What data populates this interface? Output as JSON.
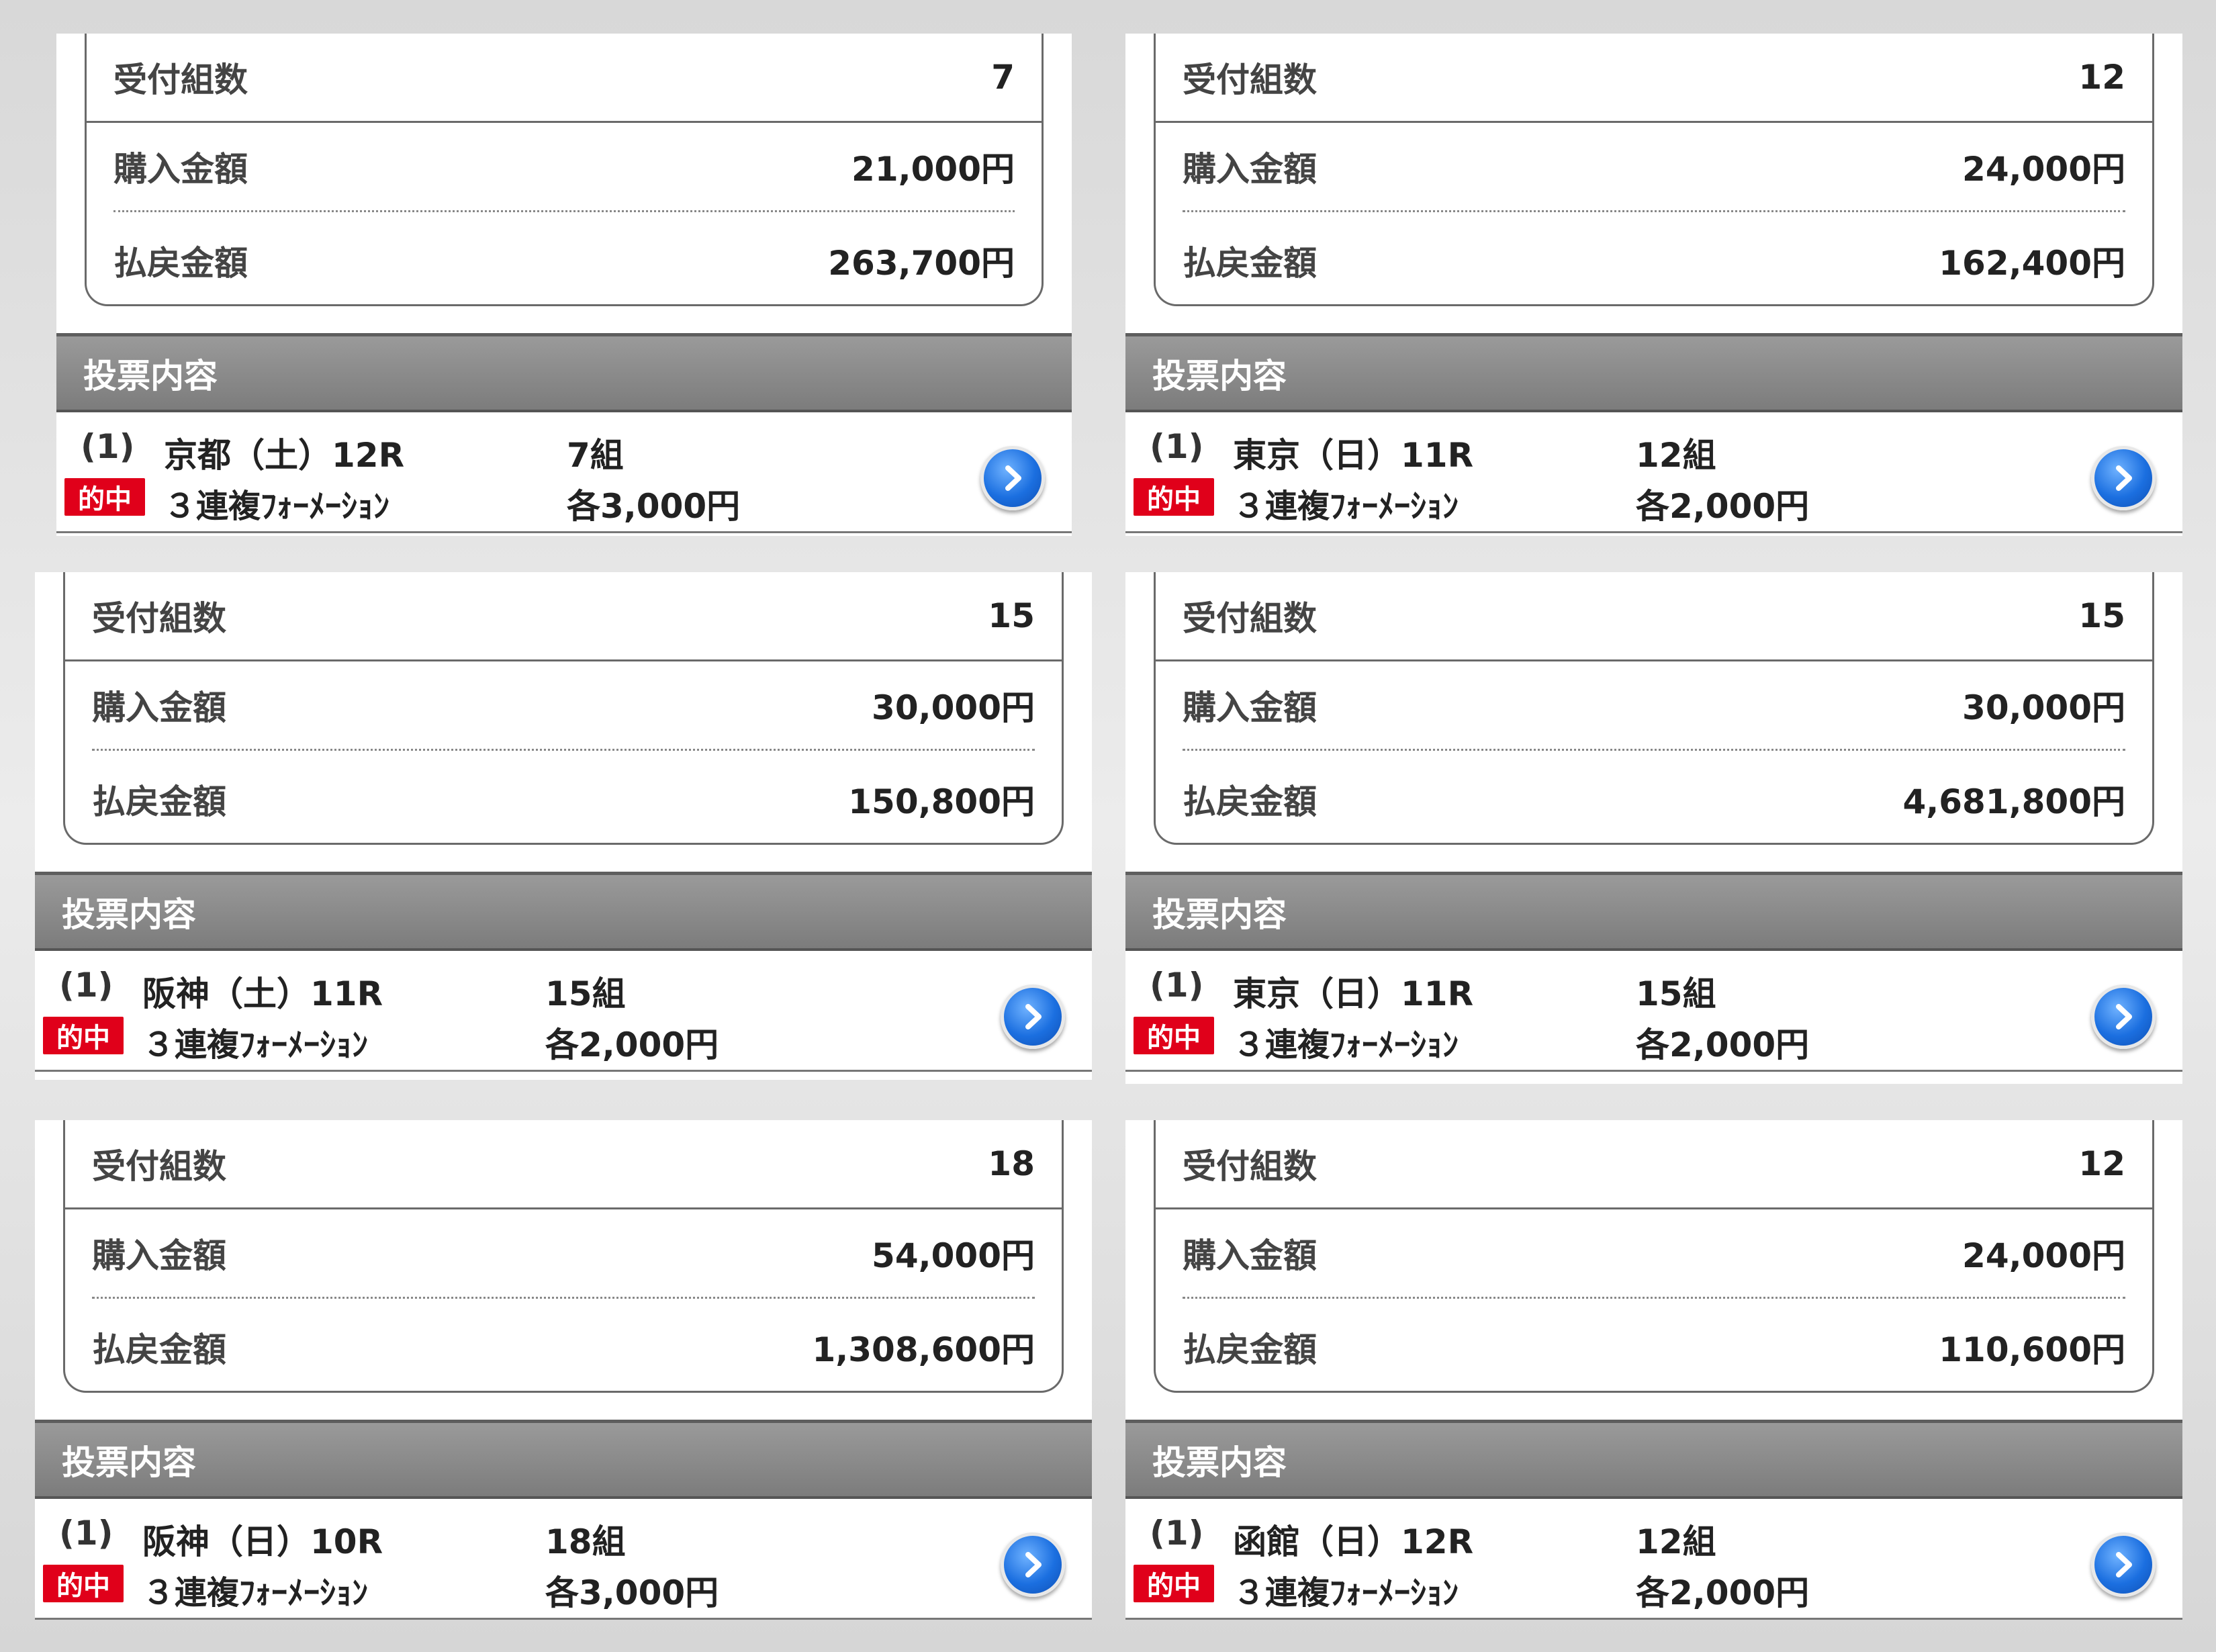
{
  "labels": {
    "count": "受付組数",
    "purchase": "購入金額",
    "payout": "払戻金額",
    "header": "投票内容",
    "hit": "的中"
  },
  "panels": [
    {
      "count": "7",
      "purchase": "21,000円",
      "payout": "263,700円",
      "index": "(1)",
      "race": "京都（土）12R",
      "combos": "7組",
      "bet_type": "３連複ﾌｫｰﾒｰｼｮﾝ",
      "each": "各3,000円"
    },
    {
      "count": "12",
      "purchase": "24,000円",
      "payout": "162,400円",
      "index": "(1)",
      "race": "東京（日）11R",
      "combos": "12組",
      "bet_type": "３連複ﾌｫｰﾒｰｼｮﾝ",
      "each": "各2,000円"
    },
    {
      "count": "15",
      "purchase": "30,000円",
      "payout": "150,800円",
      "index": "(1)",
      "race": "阪神（土）11R",
      "combos": "15組",
      "bet_type": "３連複ﾌｫｰﾒｰｼｮﾝ",
      "each": "各2,000円"
    },
    {
      "count": "15",
      "purchase": "30,000円",
      "payout": "4,681,800円",
      "index": "(1)",
      "race": "東京（日）11R",
      "combos": "15組",
      "bet_type": "３連複ﾌｫｰﾒｰｼｮﾝ",
      "each": "各2,000円"
    },
    {
      "count": "18",
      "purchase": "54,000円",
      "payout": "1,308,600円",
      "index": "(1)",
      "race": "阪神（日）10R",
      "combos": "18組",
      "bet_type": "３連複ﾌｫｰﾒｰｼｮﾝ",
      "each": "各3,000円"
    },
    {
      "count": "12",
      "purchase": "24,000円",
      "payout": "110,600円",
      "index": "(1)",
      "race": "函館（日）12R",
      "combos": "12組",
      "bet_type": "３連複ﾌｫｰﾒｰｼｮﾝ",
      "each": "各2,000円"
    }
  ]
}
